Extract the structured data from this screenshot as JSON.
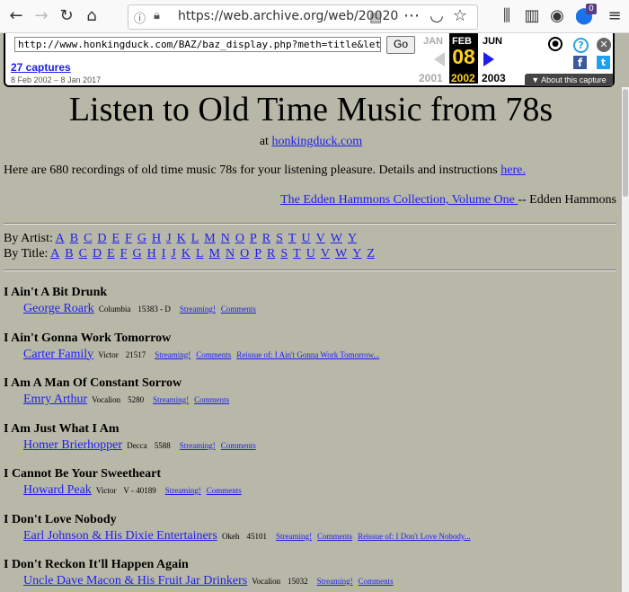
{
  "browser": {
    "url": "https://web.archive.org/web/20020",
    "badge_count": "0"
  },
  "wayback": {
    "url_input": "http://www.honkingduck.com/BAZ/baz_display.php?meth=title&let=i",
    "go_label": "Go",
    "captures_label": "27 captures",
    "date_range": "8 Feb 2002 – 8 Jan 2017",
    "prev_month": "JAN",
    "cur_month": "FEB",
    "next_month": "JUN",
    "prev_year": "2001",
    "cur_day": "08",
    "cur_year": "2002",
    "next_year": "2003",
    "about_label": "▼ About this capture",
    "help_icon_glyph": "?",
    "facebook_icon_glyph": "f",
    "twitter_icon_glyph": "t",
    "close_icon_glyph": "✕"
  },
  "page": {
    "title": "Listen to Old Time Music from 78s",
    "at_prefix": "at ",
    "site_link": "honkingduck.com",
    "intro_text": "Here are 680 recordings of old time music 78s for your listening pleasure. Details and instructions ",
    "intro_link": "here.",
    "collection_link": "The Edden Hammons Collection, Volume One ",
    "collection_suffix": "-- Edden Hammons",
    "by_artist_label": "By Artist:",
    "artist_letters": [
      "A",
      "B",
      "C",
      "D",
      "E",
      "F",
      "G",
      "H",
      "J",
      "K",
      "L",
      "M",
      "N",
      "O",
      "P",
      "R",
      "S",
      "T",
      "U",
      "V",
      "W",
      "Y"
    ],
    "by_title_label": "By Title:",
    "title_letters": [
      "A",
      "B",
      "C",
      "D",
      "E",
      "F",
      "G",
      "H",
      "I",
      "J",
      "K",
      "L",
      "M",
      "N",
      "O",
      "P",
      "R",
      "S",
      "T",
      "U",
      "V",
      "W",
      "Y",
      "Z"
    ],
    "songs": [
      {
        "title": "I Ain't A Bit Drunk",
        "artist": "George Roark",
        "label": "Columbia",
        "number": "15383 - D",
        "links": [
          "Streaming!",
          "Comments"
        ]
      },
      {
        "title": "I Ain't Gonna Work Tomorrow",
        "artist": "Carter Family",
        "label": "Victor",
        "number": "21517",
        "links": [
          "Streaming!",
          "Comments",
          "Reissue of: I Ain't Gonna Work Tomorrow..."
        ]
      },
      {
        "title": "I Am A Man Of Constant Sorrow",
        "artist": "Emry Arthur",
        "label": "Vocalion",
        "number": "5280",
        "links": [
          "Streaming!",
          "Comments"
        ]
      },
      {
        "title": "I Am Just What I Am",
        "artist": "Homer Brierhopper",
        "label": "Decca",
        "number": "5588",
        "links": [
          "Streaming!",
          "Comments"
        ]
      },
      {
        "title": "I Cannot Be Your Sweetheart",
        "artist": "Howard Peak",
        "label": "Victor",
        "number": "V - 40189",
        "links": [
          "Streaming!",
          "Comments"
        ]
      },
      {
        "title": "I Don't Love Nobody",
        "artist": "Earl Johnson & His Dixie Entertainers",
        "label": "Okeh",
        "number": "45101",
        "links": [
          "Streaming!",
          "Comments",
          "Reissue of: I Don't Love Nobody..."
        ]
      },
      {
        "title": "I Don't Reckon It'll Happen Again",
        "artist": "Uncle Dave Macon & His Fruit Jar Drinkers",
        "label": "Vocalion",
        "number": "15032",
        "links": [
          "Streaming!",
          "Comments"
        ]
      }
    ]
  },
  "colors": {
    "page_bg": "#b8b8a8",
    "link": "#1d1df0",
    "wayback_highlight": "#ffd21e"
  }
}
